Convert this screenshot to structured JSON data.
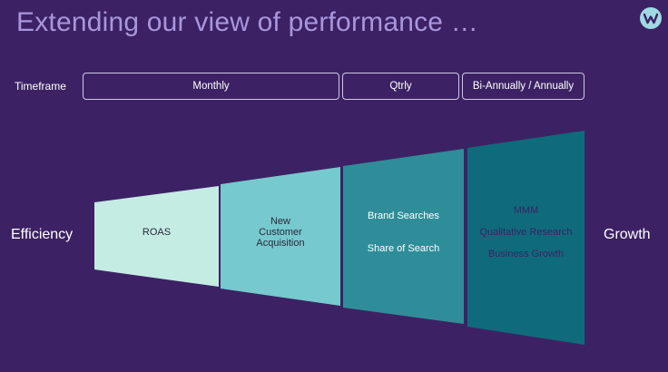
{
  "title": "Extending our view of performance …",
  "timeframe": {
    "label": "Timeframe",
    "boxes": [
      "Monthly",
      "Qtrly",
      "Bi-Annually / Annually"
    ]
  },
  "left_label": "Efficiency",
  "right_label": "Growth",
  "segments": [
    {
      "lines": [
        "ROAS"
      ],
      "fill": "#c4ece3",
      "text_color": "#2a2a3a"
    },
    {
      "lines": [
        "New",
        "Customer",
        "Acquisition"
      ],
      "fill": "#76c9ce",
      "text_color": "#2a2a3a"
    },
    {
      "lines": [
        "Brand Searches",
        "Share of Search"
      ],
      "fill": "#2f8d99",
      "text_color": "#ffffff"
    },
    {
      "lines": [
        "MMM",
        "Qualitative Research",
        "Business Growth"
      ],
      "fill": "#0f6b7c",
      "text_color": "#3c2264"
    }
  ],
  "colors": {
    "background": "#3c2264",
    "title": "#a996dd",
    "outline": "#cfc7e6"
  },
  "icons": {
    "logo": "w-logo-icon"
  }
}
